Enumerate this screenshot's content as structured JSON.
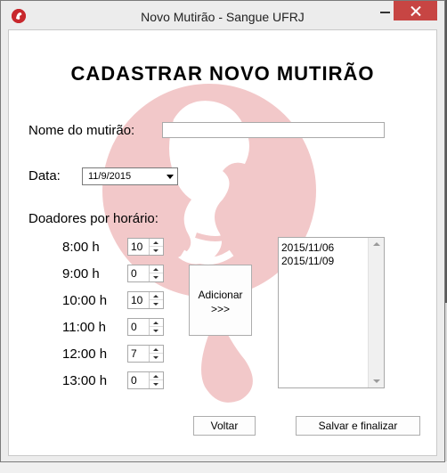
{
  "window": {
    "title": "Novo Mutirão - Sangue UFRJ"
  },
  "form": {
    "heading": "CADASTRAR NOVO MUTIRÃO",
    "name_label": "Nome do mutirão:",
    "name_value": "",
    "date_label": "Data:",
    "date_value": "11/9/2015",
    "donors_label": "Doadores por horário:"
  },
  "schedule": [
    {
      "hour": "8:00 h",
      "donors": "10"
    },
    {
      "hour": "9:00 h",
      "donors": "0"
    },
    {
      "hour": "10:00 h",
      "donors": "10"
    },
    {
      "hour": "11:00 h",
      "donors": "0"
    },
    {
      "hour": "12:00 h",
      "donors": "7"
    },
    {
      "hour": "13:00 h",
      "donors": "0"
    }
  ],
  "buttons": {
    "add_line1": "Adicionar",
    "add_line2": ">>>",
    "back": "Voltar",
    "save": "Salvar e finalizar"
  },
  "added_dates": [
    "2015/11/06",
    "2015/11/09"
  ],
  "colors": {
    "accent_close": "#c74543",
    "watermark": "#f2c8c9",
    "app_icon": "#c8282d"
  }
}
